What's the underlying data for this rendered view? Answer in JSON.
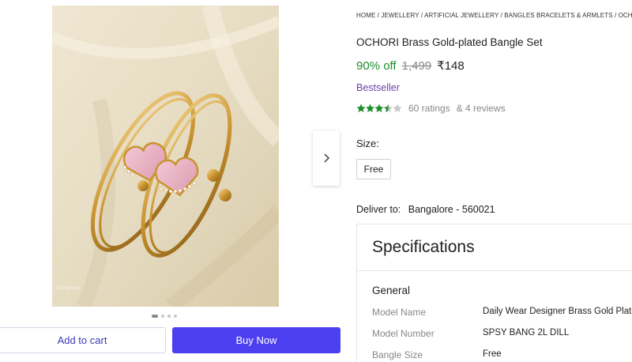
{
  "breadcrumb": "HOME / JEWELLERY / ARTIFICIAL JEWELLERY / BANGLES BRACELETS & ARMLETS / OCHORI",
  "product": {
    "title": "OCHORI Brass Gold-plated Bangle Set",
    "discount": "90% off",
    "mrp": "1,499",
    "price": "₹148",
    "badge": "Bestseller",
    "rating_value": 3.5,
    "ratings_count": "60 ratings",
    "reviews_count": "& 4 reviews"
  },
  "size": {
    "label": "Size:",
    "options": [
      "Free"
    ]
  },
  "delivery": {
    "label": "Deliver to:",
    "pincode": "Bangalore - 560021"
  },
  "gallery": {
    "watermark": "Instagram",
    "dot_count": 4,
    "active_dot": 0
  },
  "actions": {
    "add_to_cart": "Add to cart",
    "buy_now": "Buy Now"
  },
  "specifications": {
    "title": "Specifications",
    "group": "General",
    "rows": [
      {
        "key": "Model Name",
        "value": "Daily Wear Designer Brass Gold Plated"
      },
      {
        "key": "Model Number",
        "value": "SPSY BANG 2L DILL"
      },
      {
        "key": "Bangle Size",
        "value": "Free"
      }
    ]
  },
  "colors": {
    "buy_button": "#4c3ff0",
    "cart_text": "#3d3bb5",
    "discount": "#1b8f2c",
    "bestseller": "#6b3fa8",
    "star": "#1b8f2c"
  }
}
